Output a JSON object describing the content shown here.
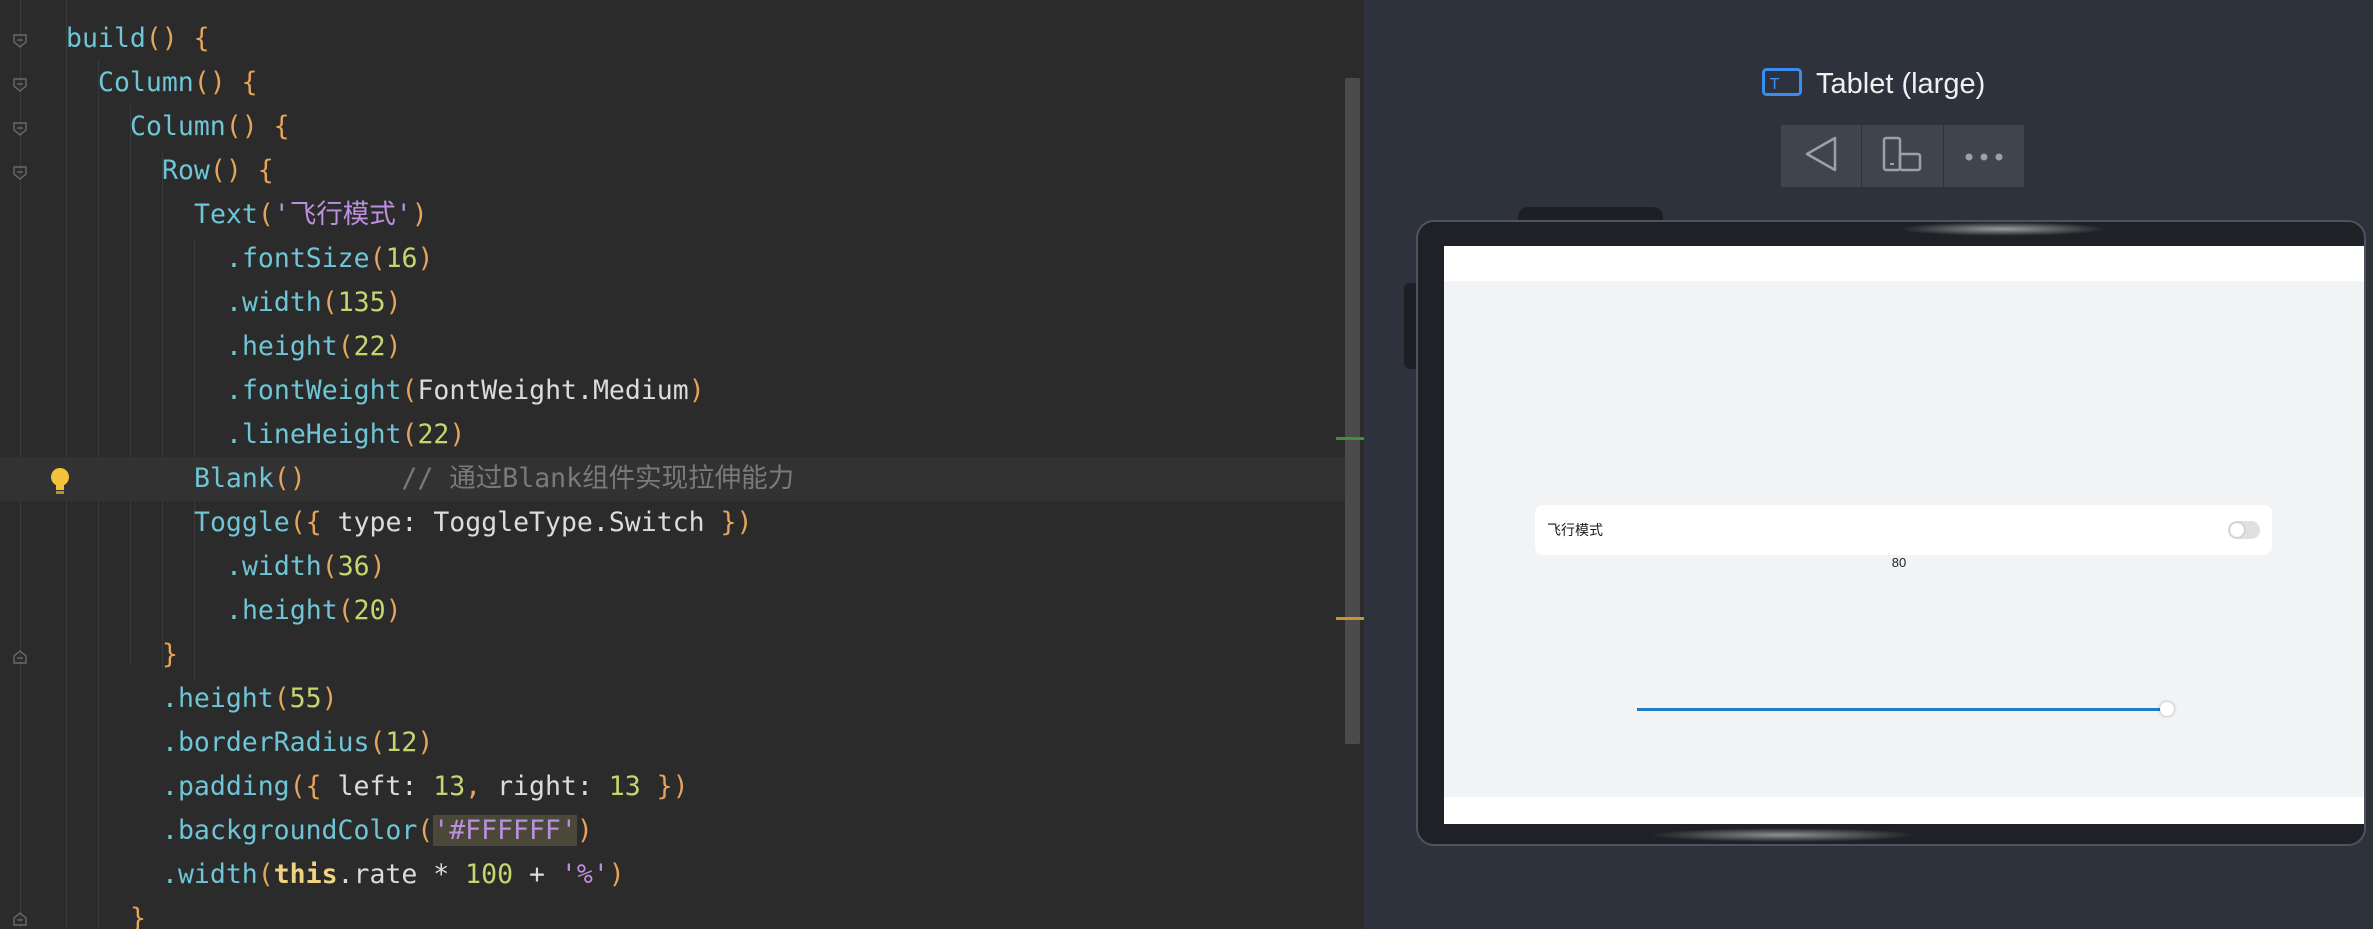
{
  "editor": {
    "lines": [
      {
        "tokens": [
          {
            "t": "build",
            "c": "fn"
          },
          {
            "t": "() {",
            "c": "pn"
          }
        ]
      },
      {
        "tokens": [
          {
            "t": "Column",
            "c": "fn"
          },
          {
            "t": "() {",
            "c": "pn"
          }
        ]
      },
      {
        "tokens": [
          {
            "t": "Column",
            "c": "fn"
          },
          {
            "t": "() {",
            "c": "pn"
          }
        ]
      },
      {
        "tokens": [
          {
            "t": "Row",
            "c": "fn"
          },
          {
            "t": "() {",
            "c": "pn"
          }
        ]
      },
      {
        "tokens": [
          {
            "t": "Text",
            "c": "fn"
          },
          {
            "t": "(",
            "c": "pn"
          },
          {
            "t": "'飞行模式'",
            "c": "str"
          },
          {
            "t": ")",
            "c": "pn"
          }
        ]
      },
      {
        "tokens": [
          {
            "t": ".fontSize",
            "c": "fn"
          },
          {
            "t": "(",
            "c": "pn"
          },
          {
            "t": "16",
            "c": "num"
          },
          {
            "t": ")",
            "c": "pn"
          }
        ]
      },
      {
        "tokens": [
          {
            "t": ".width",
            "c": "fn"
          },
          {
            "t": "(",
            "c": "pn"
          },
          {
            "t": "135",
            "c": "num"
          },
          {
            "t": ")",
            "c": "pn"
          }
        ]
      },
      {
        "tokens": [
          {
            "t": ".height",
            "c": "fn"
          },
          {
            "t": "(",
            "c": "pn"
          },
          {
            "t": "22",
            "c": "num"
          },
          {
            "t": ")",
            "c": "pn"
          }
        ]
      },
      {
        "tokens": [
          {
            "t": ".fontWeight",
            "c": "fn"
          },
          {
            "t": "(",
            "c": "pn"
          },
          {
            "t": "FontWeight.Medium",
            "c": "pl"
          },
          {
            "t": ")",
            "c": "pn"
          }
        ]
      },
      {
        "tokens": [
          {
            "t": ".lineHeight",
            "c": "fn"
          },
          {
            "t": "(",
            "c": "pn"
          },
          {
            "t": "22",
            "c": "num"
          },
          {
            "t": ")",
            "c": "pn"
          }
        ]
      },
      {
        "tokens": [
          {
            "t": "Blank",
            "c": "fn"
          },
          {
            "t": "()",
            "c": "pn"
          },
          {
            "t": "      // 通过Blank组件实现拉伸能力",
            "c": "cm"
          }
        ]
      },
      {
        "tokens": [
          {
            "t": "Toggle",
            "c": "fn"
          },
          {
            "t": "({ ",
            "c": "pn"
          },
          {
            "t": "type: ToggleType.Switch ",
            "c": "pl"
          },
          {
            "t": "})",
            "c": "pn"
          }
        ]
      },
      {
        "tokens": [
          {
            "t": ".width",
            "c": "fn"
          },
          {
            "t": "(",
            "c": "pn"
          },
          {
            "t": "36",
            "c": "num"
          },
          {
            "t": ")",
            "c": "pn"
          }
        ]
      },
      {
        "tokens": [
          {
            "t": ".height",
            "c": "fn"
          },
          {
            "t": "(",
            "c": "pn"
          },
          {
            "t": "20",
            "c": "num"
          },
          {
            "t": ")",
            "c": "pn"
          }
        ]
      },
      {
        "tokens": [
          {
            "t": "}",
            "c": "pn"
          }
        ]
      },
      {
        "tokens": [
          {
            "t": ".height",
            "c": "fn"
          },
          {
            "t": "(",
            "c": "pn"
          },
          {
            "t": "55",
            "c": "num"
          },
          {
            "t": ")",
            "c": "pn"
          }
        ]
      },
      {
        "tokens": [
          {
            "t": ".borderRadius",
            "c": "fn"
          },
          {
            "t": "(",
            "c": "pn"
          },
          {
            "t": "12",
            "c": "num"
          },
          {
            "t": ")",
            "c": "pn"
          }
        ]
      },
      {
        "tokens": [
          {
            "t": ".padding",
            "c": "fn"
          },
          {
            "t": "({ ",
            "c": "pn"
          },
          {
            "t": "left: ",
            "c": "pl"
          },
          {
            "t": "13",
            "c": "num"
          },
          {
            "t": ", ",
            "c": "pn"
          },
          {
            "t": "right: ",
            "c": "pl"
          },
          {
            "t": "13",
            "c": "num"
          },
          {
            "t": " })",
            "c": "pn"
          }
        ]
      },
      {
        "tokens": [
          {
            "t": ".backgroundColor",
            "c": "fn"
          },
          {
            "t": "(",
            "c": "pn"
          },
          {
            "t": "'#FFFFFF'",
            "c": "str strhl"
          },
          {
            "t": ")",
            "c": "pn"
          }
        ]
      },
      {
        "tokens": [
          {
            "t": ".width",
            "c": "fn"
          },
          {
            "t": "(",
            "c": "pn"
          },
          {
            "t": "this",
            "c": "kw"
          },
          {
            "t": ".rate * ",
            "c": "op"
          },
          {
            "t": "100",
            "c": "num"
          },
          {
            "t": " + ",
            "c": "op"
          },
          {
            "t": "'%'",
            "c": "str"
          },
          {
            "t": ")",
            "c": "pn"
          }
        ]
      },
      {
        "tokens": [
          {
            "t": "}",
            "c": "pn"
          }
        ]
      }
    ]
  },
  "preview": {
    "device_name": "Tablet (large)",
    "toolbar_icons": [
      "back-triangle-icon",
      "rotate-device-icon",
      "more-dots-icon"
    ],
    "screen": {
      "row_text": "飞行模式",
      "rate_label": "80",
      "toggle_on": false,
      "slider_value_fraction": 1.0
    }
  },
  "colors": {
    "accent": "#1f7ac9",
    "editor_bg": "#2b2b2b",
    "preview_bg": "#2e323c"
  }
}
